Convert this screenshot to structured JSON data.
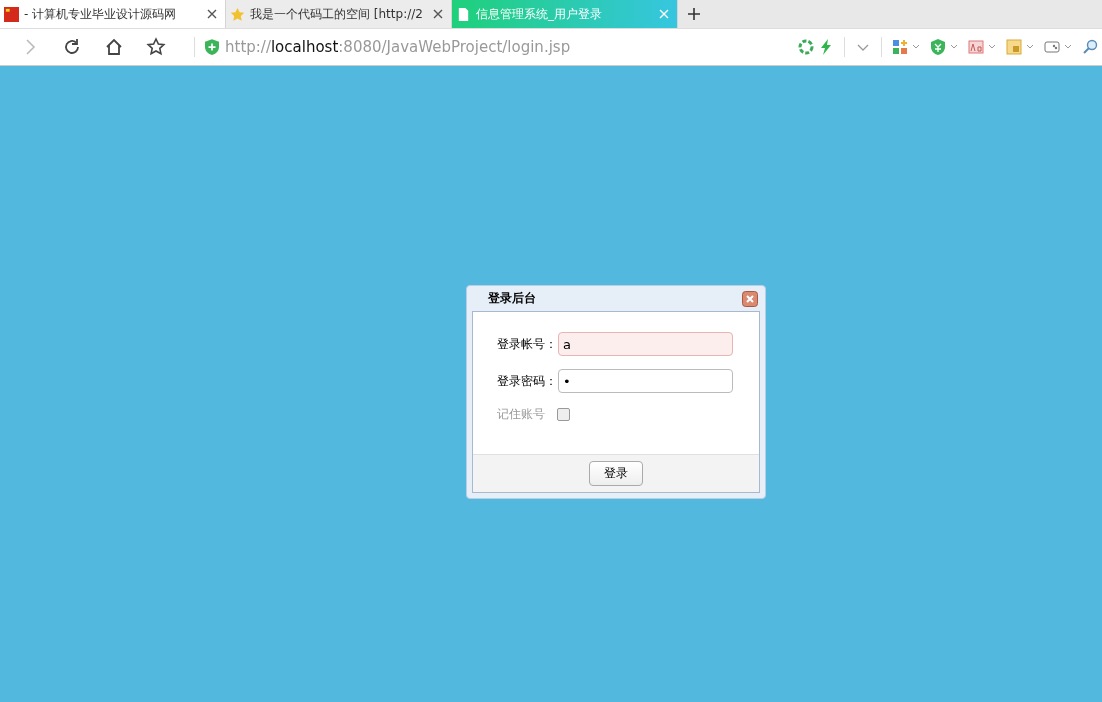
{
  "tabs": [
    {
      "title": "- 计算机专业毕业设计源码网",
      "kind": "flag",
      "selected": false
    },
    {
      "title": "我是一个代码工的空间 [http://2",
      "kind": "star",
      "selected": false
    },
    {
      "title": "信息管理系统_用户登录",
      "kind": "page",
      "selected": true
    }
  ],
  "address": {
    "scheme": "http://",
    "host": "localhost",
    "rest": ":8080/JavaWebProject/login.jsp"
  },
  "dialog": {
    "title": "登录后台",
    "fields": [
      {
        "label": "登录帐号：",
        "value": "a",
        "invalid": true
      },
      {
        "label": "登录密码：",
        "value": "•",
        "invalid": false
      }
    ],
    "remember": {
      "label": "记住账号",
      "checked": false
    },
    "button": "登录"
  }
}
